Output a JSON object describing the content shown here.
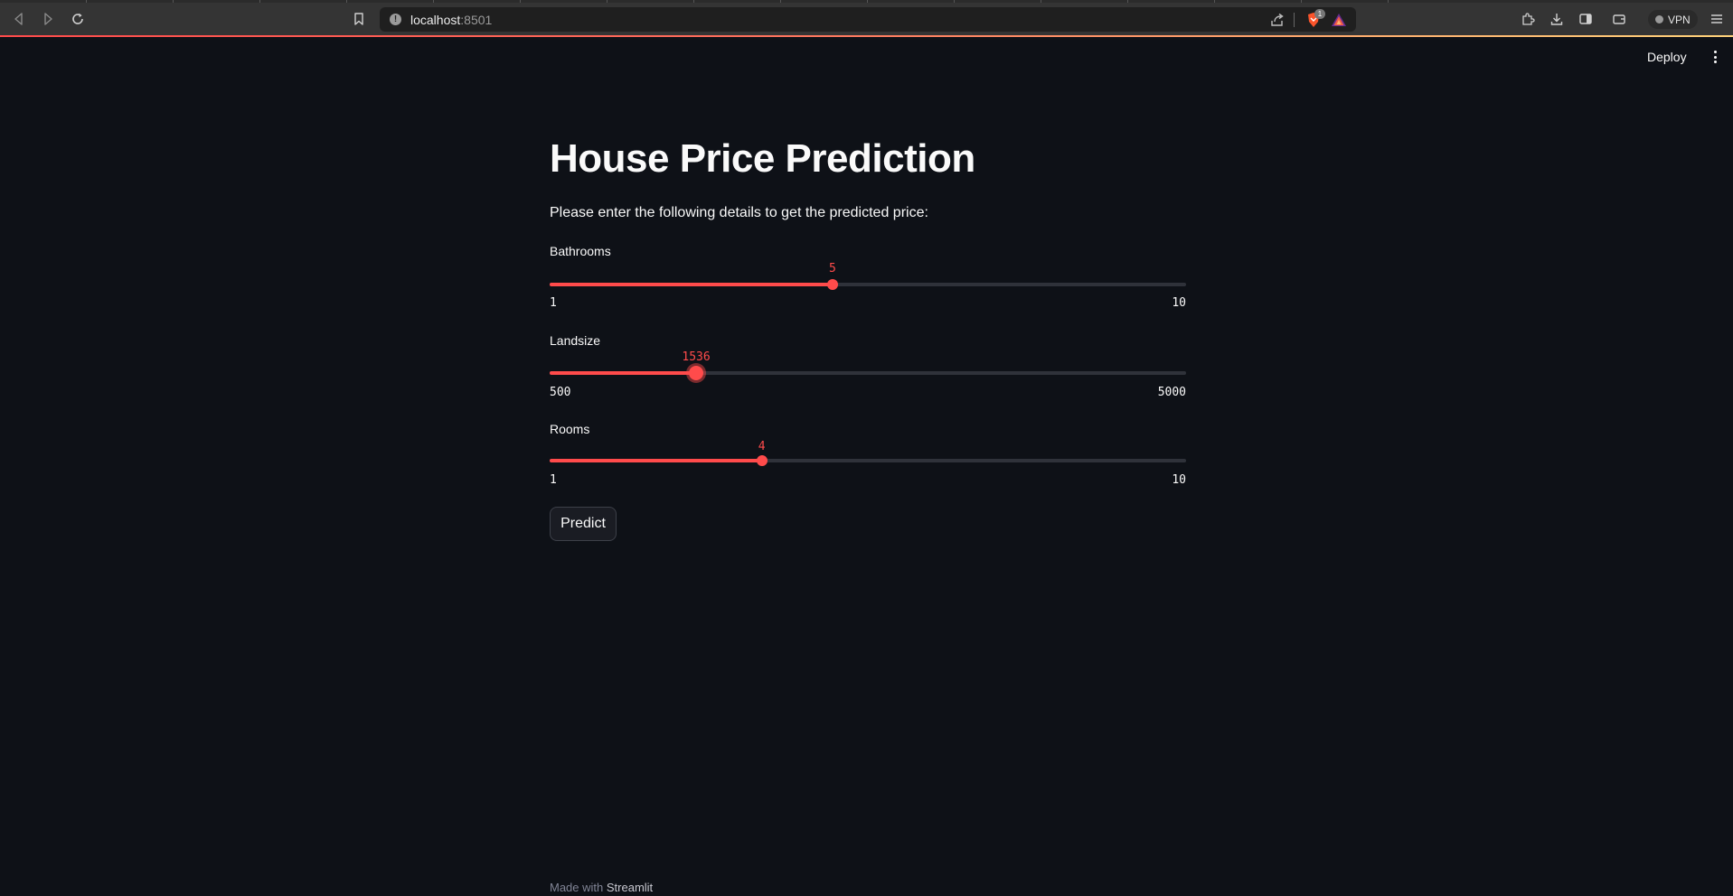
{
  "browser": {
    "url_host": "localhost",
    "url_port": ":8501",
    "shields_badge": "1",
    "vpn_label": "VPN"
  },
  "header": {
    "deploy_label": "Deploy"
  },
  "main": {
    "title": "House Price Prediction",
    "subtitle": "Please enter the following details to get the predicted price:",
    "sliders": [
      {
        "label": "Bathrooms",
        "value": 5,
        "min": 1,
        "max": 10,
        "value_text": "5",
        "min_text": "1",
        "max_text": "10"
      },
      {
        "label": "Landsize",
        "value": 1536,
        "min": 500,
        "max": 5000,
        "value_text": "1536",
        "min_text": "500",
        "max_text": "5000"
      },
      {
        "label": "Rooms",
        "value": 4,
        "min": 1,
        "max": 10,
        "value_text": "4",
        "min_text": "1",
        "max_text": "10"
      }
    ],
    "predict_label": "Predict"
  },
  "footer": {
    "made_with": "Made with",
    "brand": "Streamlit"
  },
  "colors": {
    "accent": "#ff4b4b",
    "background": "#0e1117",
    "track": "#2f323a"
  }
}
